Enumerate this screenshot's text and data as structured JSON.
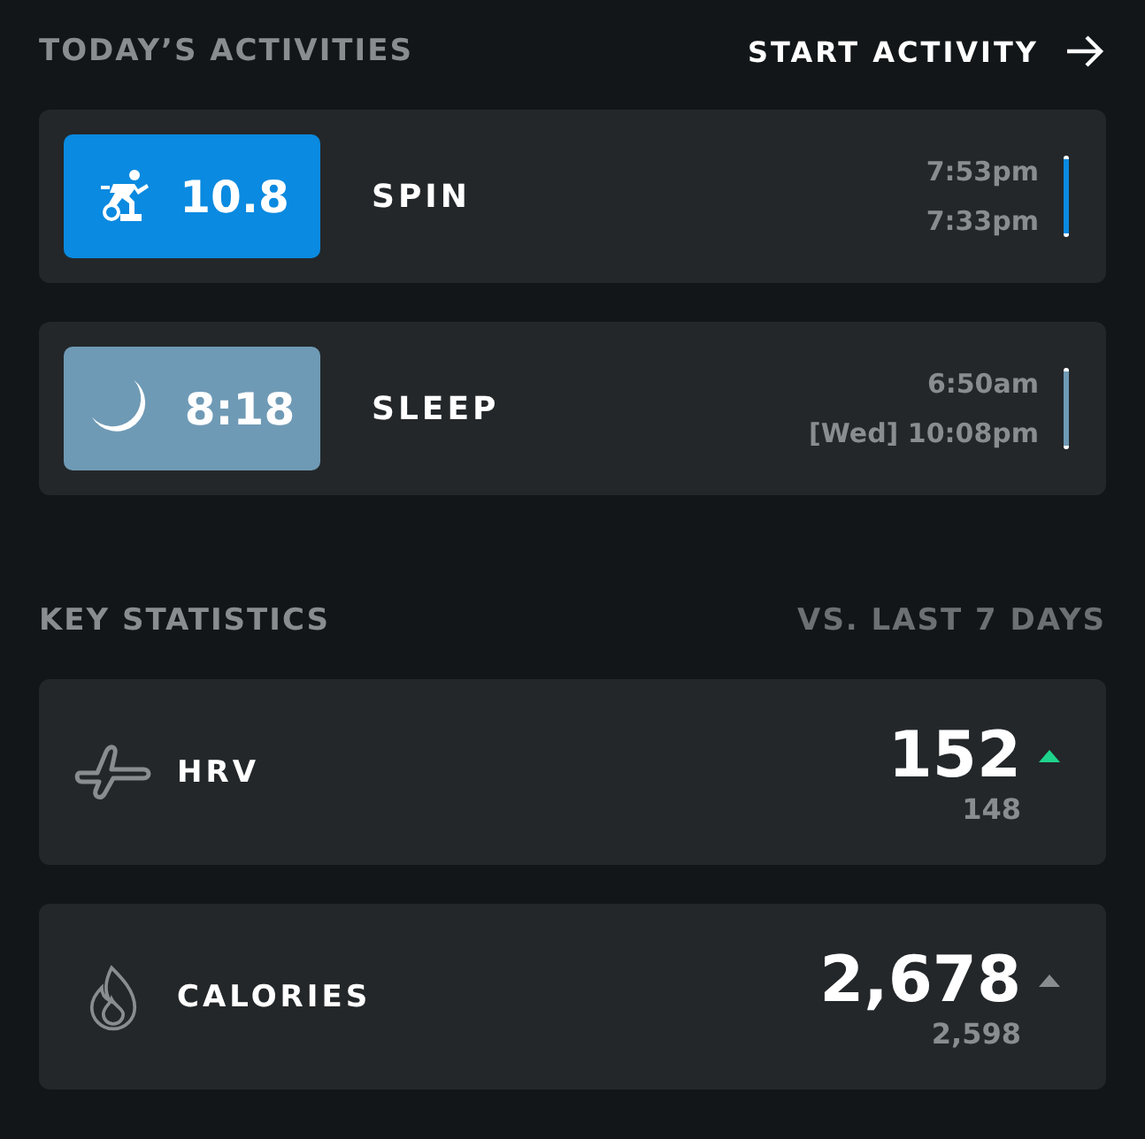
{
  "activities_header": {
    "title": "TODAY’S ACTIVITIES",
    "action": "START ACTIVITY"
  },
  "activities": [
    {
      "kind": "spin",
      "value": "10.8",
      "name": "SPIN",
      "end_time": "7:53pm",
      "start_time": "7:33pm",
      "color": "#0a8ae0"
    },
    {
      "kind": "sleep",
      "value": "8:18",
      "name": "SLEEP",
      "end_time": "6:50am",
      "start_time": "[Wed] 10:08pm",
      "color": "#6f9ab5"
    }
  ],
  "statistics_header": {
    "title": "KEY STATISTICS",
    "comparison": "VS. LAST 7 DAYS"
  },
  "statistics": [
    {
      "kind": "hrv",
      "name": "HRV",
      "value": "152",
      "previous": "148",
      "color": "#1ed48c"
    },
    {
      "kind": "calories",
      "name": "CALORIES",
      "value": "2,678",
      "previous": "2,598",
      "color": "#8a8d8f"
    }
  ]
}
